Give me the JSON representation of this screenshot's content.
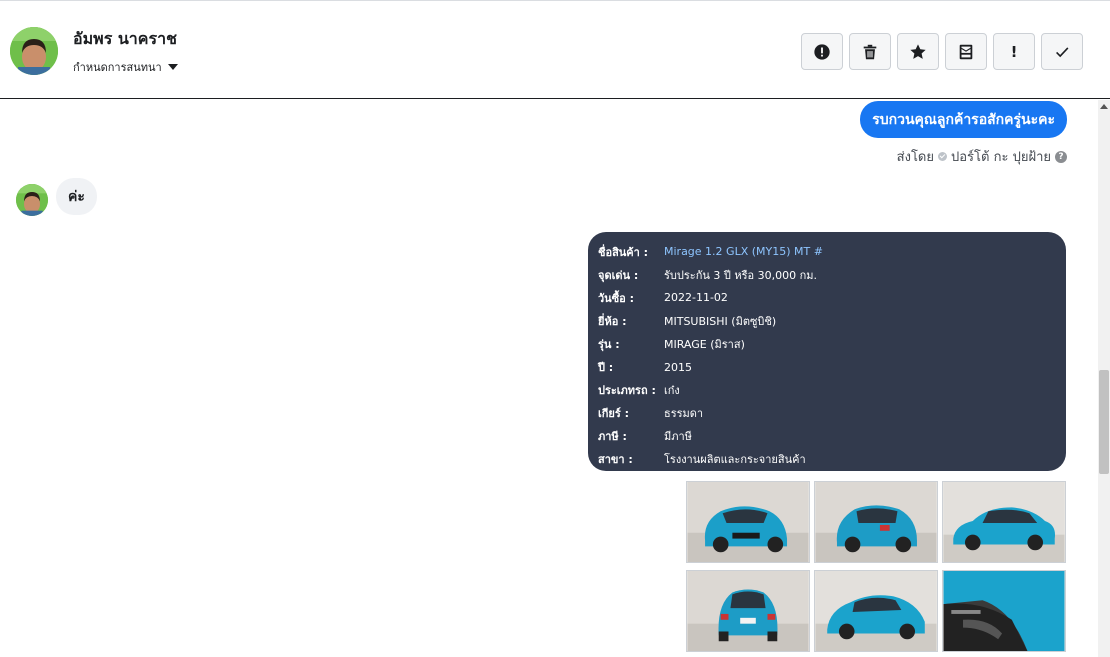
{
  "header": {
    "contact_name": "อัมพร นาคราช",
    "conversation_setting": "กำหนดการสนทนา"
  },
  "toolbar": {
    "buttons": [
      {
        "icon": "alert-circle-icon"
      },
      {
        "icon": "trash-icon"
      },
      {
        "icon": "star-icon"
      },
      {
        "icon": "archive-icon"
      },
      {
        "icon": "exclamation-icon",
        "label": "!"
      },
      {
        "icon": "check-icon"
      }
    ]
  },
  "messages": {
    "outgoing_text": "รบกวนคุณลูกค้ารอสักครู่นะคะ",
    "sent_by_label": "ส่งโดย",
    "sent_by_name": "ปอร์โต้ กะ ปุยฝ้าย",
    "incoming_text": "ค่ะ"
  },
  "product_card": {
    "rows": [
      {
        "label": "ชื่อสินค้า :",
        "value": "Mirage 1.2 GLX (MY15) MT #"
      },
      {
        "label": "จุดเด่น :",
        "value": "รับประกัน 3 ปี หรือ 30,000 กม."
      },
      {
        "label": "วันซื้อ :",
        "value": "2022-11-02"
      },
      {
        "label": "ยี่ห้อ :",
        "value": "MITSUBISHI (มิตซูบิชิ)"
      },
      {
        "label": "รุ่น :",
        "value": "MIRAGE (มิราส)"
      },
      {
        "label": "ปี :",
        "value": "2015"
      },
      {
        "label": "ประเภทรถ :",
        "value": "เก๋ง"
      },
      {
        "label": "เกียร์ :",
        "value": "ธรรมดา"
      },
      {
        "label": "ภาษี :",
        "value": "มีภาษี"
      },
      {
        "label": "สาขา :",
        "value": "โรงงานผลิตและกระจายสินค้า"
      }
    ]
  },
  "colors": {
    "accent": "#1877f2",
    "card_bg": "#323a4d",
    "car_body": "#1b9fc9"
  }
}
